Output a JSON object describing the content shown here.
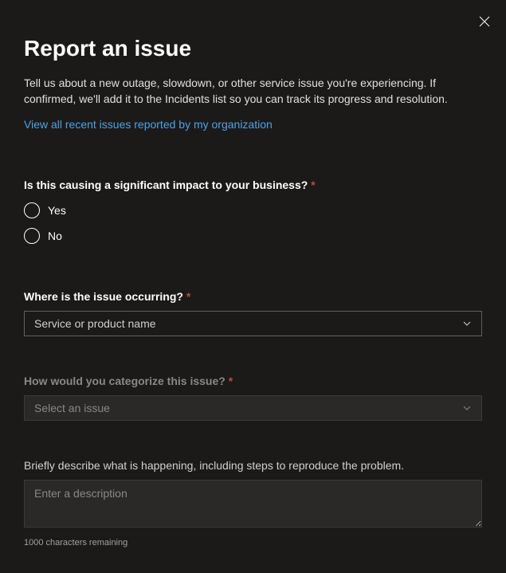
{
  "header": {
    "title": "Report an issue",
    "description": "Tell us about a new outage, slowdown, or other service issue you're experiencing. If confirmed, we'll add it to the Incidents list so you can track its progress and resolution.",
    "link": "View all recent issues reported by my organization"
  },
  "form": {
    "impact": {
      "label": "Is this causing a significant impact to your business?",
      "required": "*",
      "options": {
        "yes": "Yes",
        "no": "No"
      }
    },
    "location": {
      "label": "Where is the issue occurring?",
      "required": "*",
      "placeholder": "Service or product name"
    },
    "category": {
      "label": "How would you categorize this issue?",
      "required": "*",
      "placeholder": "Select an issue"
    },
    "description": {
      "label": "Briefly describe what is happening, including steps to reproduce the problem.",
      "placeholder": "Enter a description",
      "charCount": "1000 characters remaining"
    }
  }
}
